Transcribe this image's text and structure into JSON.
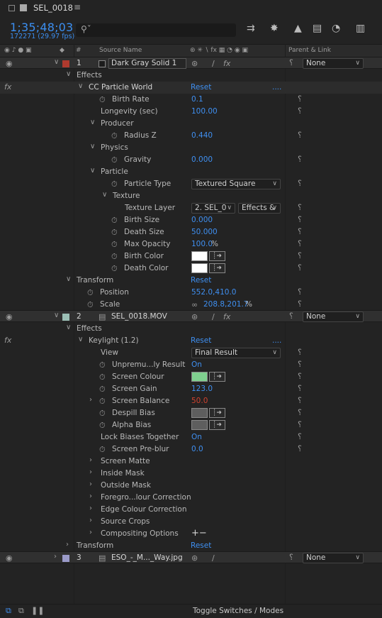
{
  "tab": {
    "title": "SEL_0018",
    "menu_icon": "hamburger-icon"
  },
  "timecode": {
    "value": "1;35;48;03",
    "frames": "172271 (29.97 fps)"
  },
  "search": {
    "placeholder": "",
    "icon": "search-icon"
  },
  "columns": {
    "num": "#",
    "source": "Source Name",
    "parent": "Parent & Link"
  },
  "layers": [
    {
      "num": "1",
      "name": "Dark Gray Solid 1",
      "color": "#b03a2e",
      "parent": "None"
    },
    {
      "num": "2",
      "name": "SEL_0018.MOV",
      "color": "#9bbfb5",
      "parent": "None"
    },
    {
      "num": "3",
      "name": "ESO_-_M..._Way.jpg",
      "color": "#9a9ac8",
      "parent": "None"
    }
  ],
  "l1": {
    "effects": "Effects",
    "ccpw": "CC Particle World",
    "reset": "Reset",
    "dots": "....",
    "birth_rate": {
      "label": "Birth Rate",
      "value": "0.1"
    },
    "longevity": {
      "label": "Longevity (sec)",
      "value": "100.00"
    },
    "producer": "Producer",
    "radius_z": {
      "label": "Radius Z",
      "value": "0.440"
    },
    "physics": "Physics",
    "gravity": {
      "label": "Gravity",
      "value": "0.000"
    },
    "particle": "Particle",
    "particle_type": {
      "label": "Particle Type",
      "value": "Textured Square"
    },
    "texture": "Texture",
    "texture_layer": {
      "label": "Texture Layer",
      "value": "2. SEL_0",
      "value2": "Effects &"
    },
    "birth_size": {
      "label": "Birth Size",
      "value": "0.000"
    },
    "death_size": {
      "label": "Death Size",
      "value": "50.000"
    },
    "max_opacity": {
      "label": "Max Opacity",
      "value": "100.0",
      "unit": "%"
    },
    "birth_color": {
      "label": "Birth Color",
      "color": "#ffffff"
    },
    "death_color": {
      "label": "Death Color",
      "color": "#ffffff"
    },
    "transform": "Transform",
    "t_reset": "Reset",
    "position": {
      "label": "Position",
      "value": "552.0,410.0"
    },
    "scale": {
      "label": "Scale",
      "value": "208.8,201.7",
      "unit": "%"
    }
  },
  "l2": {
    "effects": "Effects",
    "keylight": "Keylight (1.2)",
    "reset": "Reset",
    "dots": "....",
    "view": {
      "label": "View",
      "value": "Final Result"
    },
    "unpremult": {
      "label": "Unpremu...ly Result",
      "value": "On"
    },
    "screen_colour": {
      "label": "Screen Colour",
      "color": "#7fd08f"
    },
    "screen_gain": {
      "label": "Screen Gain",
      "value": "123.0"
    },
    "screen_balance": {
      "label": "Screen Balance",
      "value": "50.0"
    },
    "despill_bias": {
      "label": "Despill Bias",
      "color": "#5e5e5e"
    },
    "alpha_bias": {
      "label": "Alpha Bias",
      "color": "#5e5e5e"
    },
    "lock_biases": {
      "label": "Lock Biases Together",
      "value": "On"
    },
    "screen_preblur": {
      "label": "Screen Pre-blur",
      "value": "0.0"
    },
    "groups": [
      "Screen Matte",
      "Inside Mask",
      "Outside Mask",
      "Foregro...lour Correction",
      "Edge Colour Correction",
      "Source Crops",
      "Compositing Options"
    ],
    "plusminus": "+−",
    "transform": "Transform",
    "t_reset": "Reset"
  },
  "footer": {
    "toggle": "Toggle Switches / Modes"
  }
}
